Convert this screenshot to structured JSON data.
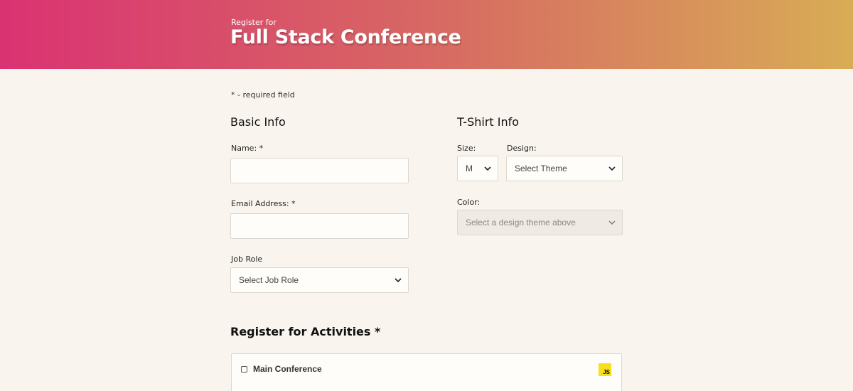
{
  "header": {
    "pre_title": "Register for",
    "title": "Full Stack Conference"
  },
  "required_note": "* - required field",
  "basic_info": {
    "heading": "Basic Info",
    "name_label": "Name: *",
    "name_value": "",
    "email_label": "Email Address: *",
    "email_value": "",
    "job_role_label": "Job Role",
    "job_role_selected": "Select Job Role"
  },
  "tshirt_info": {
    "heading": "T-Shirt Info",
    "size_label": "Size:",
    "size_selected": "M",
    "design_label": "Design:",
    "design_selected": "Select Theme",
    "color_label": "Color:",
    "color_selected": "Select a design theme above"
  },
  "activities": {
    "heading": "Register for Activities *",
    "items": [
      {
        "label": "Main Conference",
        "checked": false,
        "icon": "javascript-icon",
        "icon_text": "JS"
      }
    ]
  },
  "colors": {
    "header_gradient_start": "#da3272",
    "header_gradient_mid": "#d76863",
    "header_gradient_end": "#d8ac55",
    "page_background": "#f9f5ee",
    "js_badge": "#f7df1e"
  }
}
